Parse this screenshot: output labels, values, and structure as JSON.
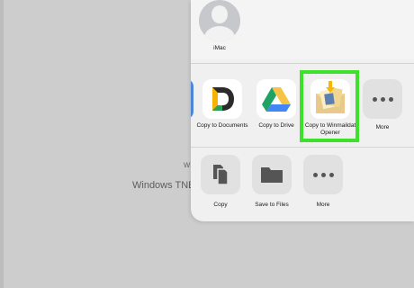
{
  "background": {
    "partial_text_top": "wi",
    "partial_text_bottom": "Windows TNEF"
  },
  "share_sheet": {
    "person": {
      "name": "iMac",
      "icon": "person-avatar-icon"
    },
    "apps": [
      {
        "label": "Copy to Documents",
        "icon": "documents-d-icon"
      },
      {
        "label": "Copy to Drive",
        "icon": "google-drive-icon"
      },
      {
        "label": "Copy to Winmaildat Opener",
        "icon": "winmaildat-opener-icon"
      },
      {
        "label": "More",
        "icon": "more-dots-icon"
      }
    ],
    "actions": [
      {
        "label": "Copy",
        "icon": "copy-icon"
      },
      {
        "label": "Save to Files",
        "icon": "folder-icon"
      },
      {
        "label": "More",
        "icon": "more-dots-icon"
      }
    ]
  },
  "colors": {
    "highlight": "#3de02a",
    "drive_yellow": "#f6c343",
    "drive_green": "#1ea362",
    "drive_blue": "#4285f4"
  }
}
